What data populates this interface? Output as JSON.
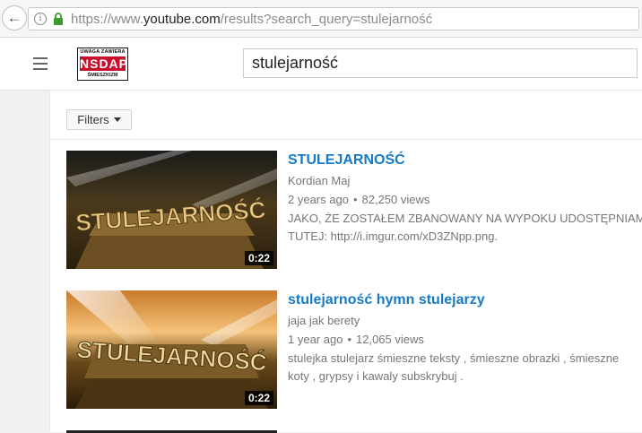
{
  "browser": {
    "url_prefix": "https://www.",
    "url_host": "youtube.com",
    "url_path": "/results?search_query=stulejarność"
  },
  "header": {
    "logo_line1": "UWAGA ZAWIERA",
    "logo_line2": "NSDAP",
    "logo_line3": "ŚMIESZKIZM",
    "search_value": "stulejarność"
  },
  "filters": {
    "label": "Filters"
  },
  "results": [
    {
      "title": "STULEJARNOŚĆ",
      "channel": "Kordian Maj",
      "age": "2 years ago",
      "views": "82,250 views",
      "desc_line1": "JAKO, ŻE ZOSTAŁEM ZBANOWANY NA WYPOKU UDOSTĘPNIAM",
      "desc_line2": "TUTEJ: http://i.imgur.com/xD3ZNpp.png.",
      "duration": "0:22",
      "thumb_text": "STULEJARNOŚĆ"
    },
    {
      "title": "stulejarność hymn stulejarzy",
      "channel": "jaja jak berety",
      "age": "1 year ago",
      "views": "12,065 views",
      "desc_line1": "stulejka stulejarz śmieszne teksty , śmieszne obrazki , śmieszne",
      "desc_line2": "koty , grypsy i kawaly subskrybuj .",
      "duration": "0:22",
      "thumb_text": "STULEJARNOŚĆ"
    }
  ],
  "colors": {
    "link": "#167ac6",
    "meta": "#767676",
    "logo_red": "#c8102e"
  }
}
